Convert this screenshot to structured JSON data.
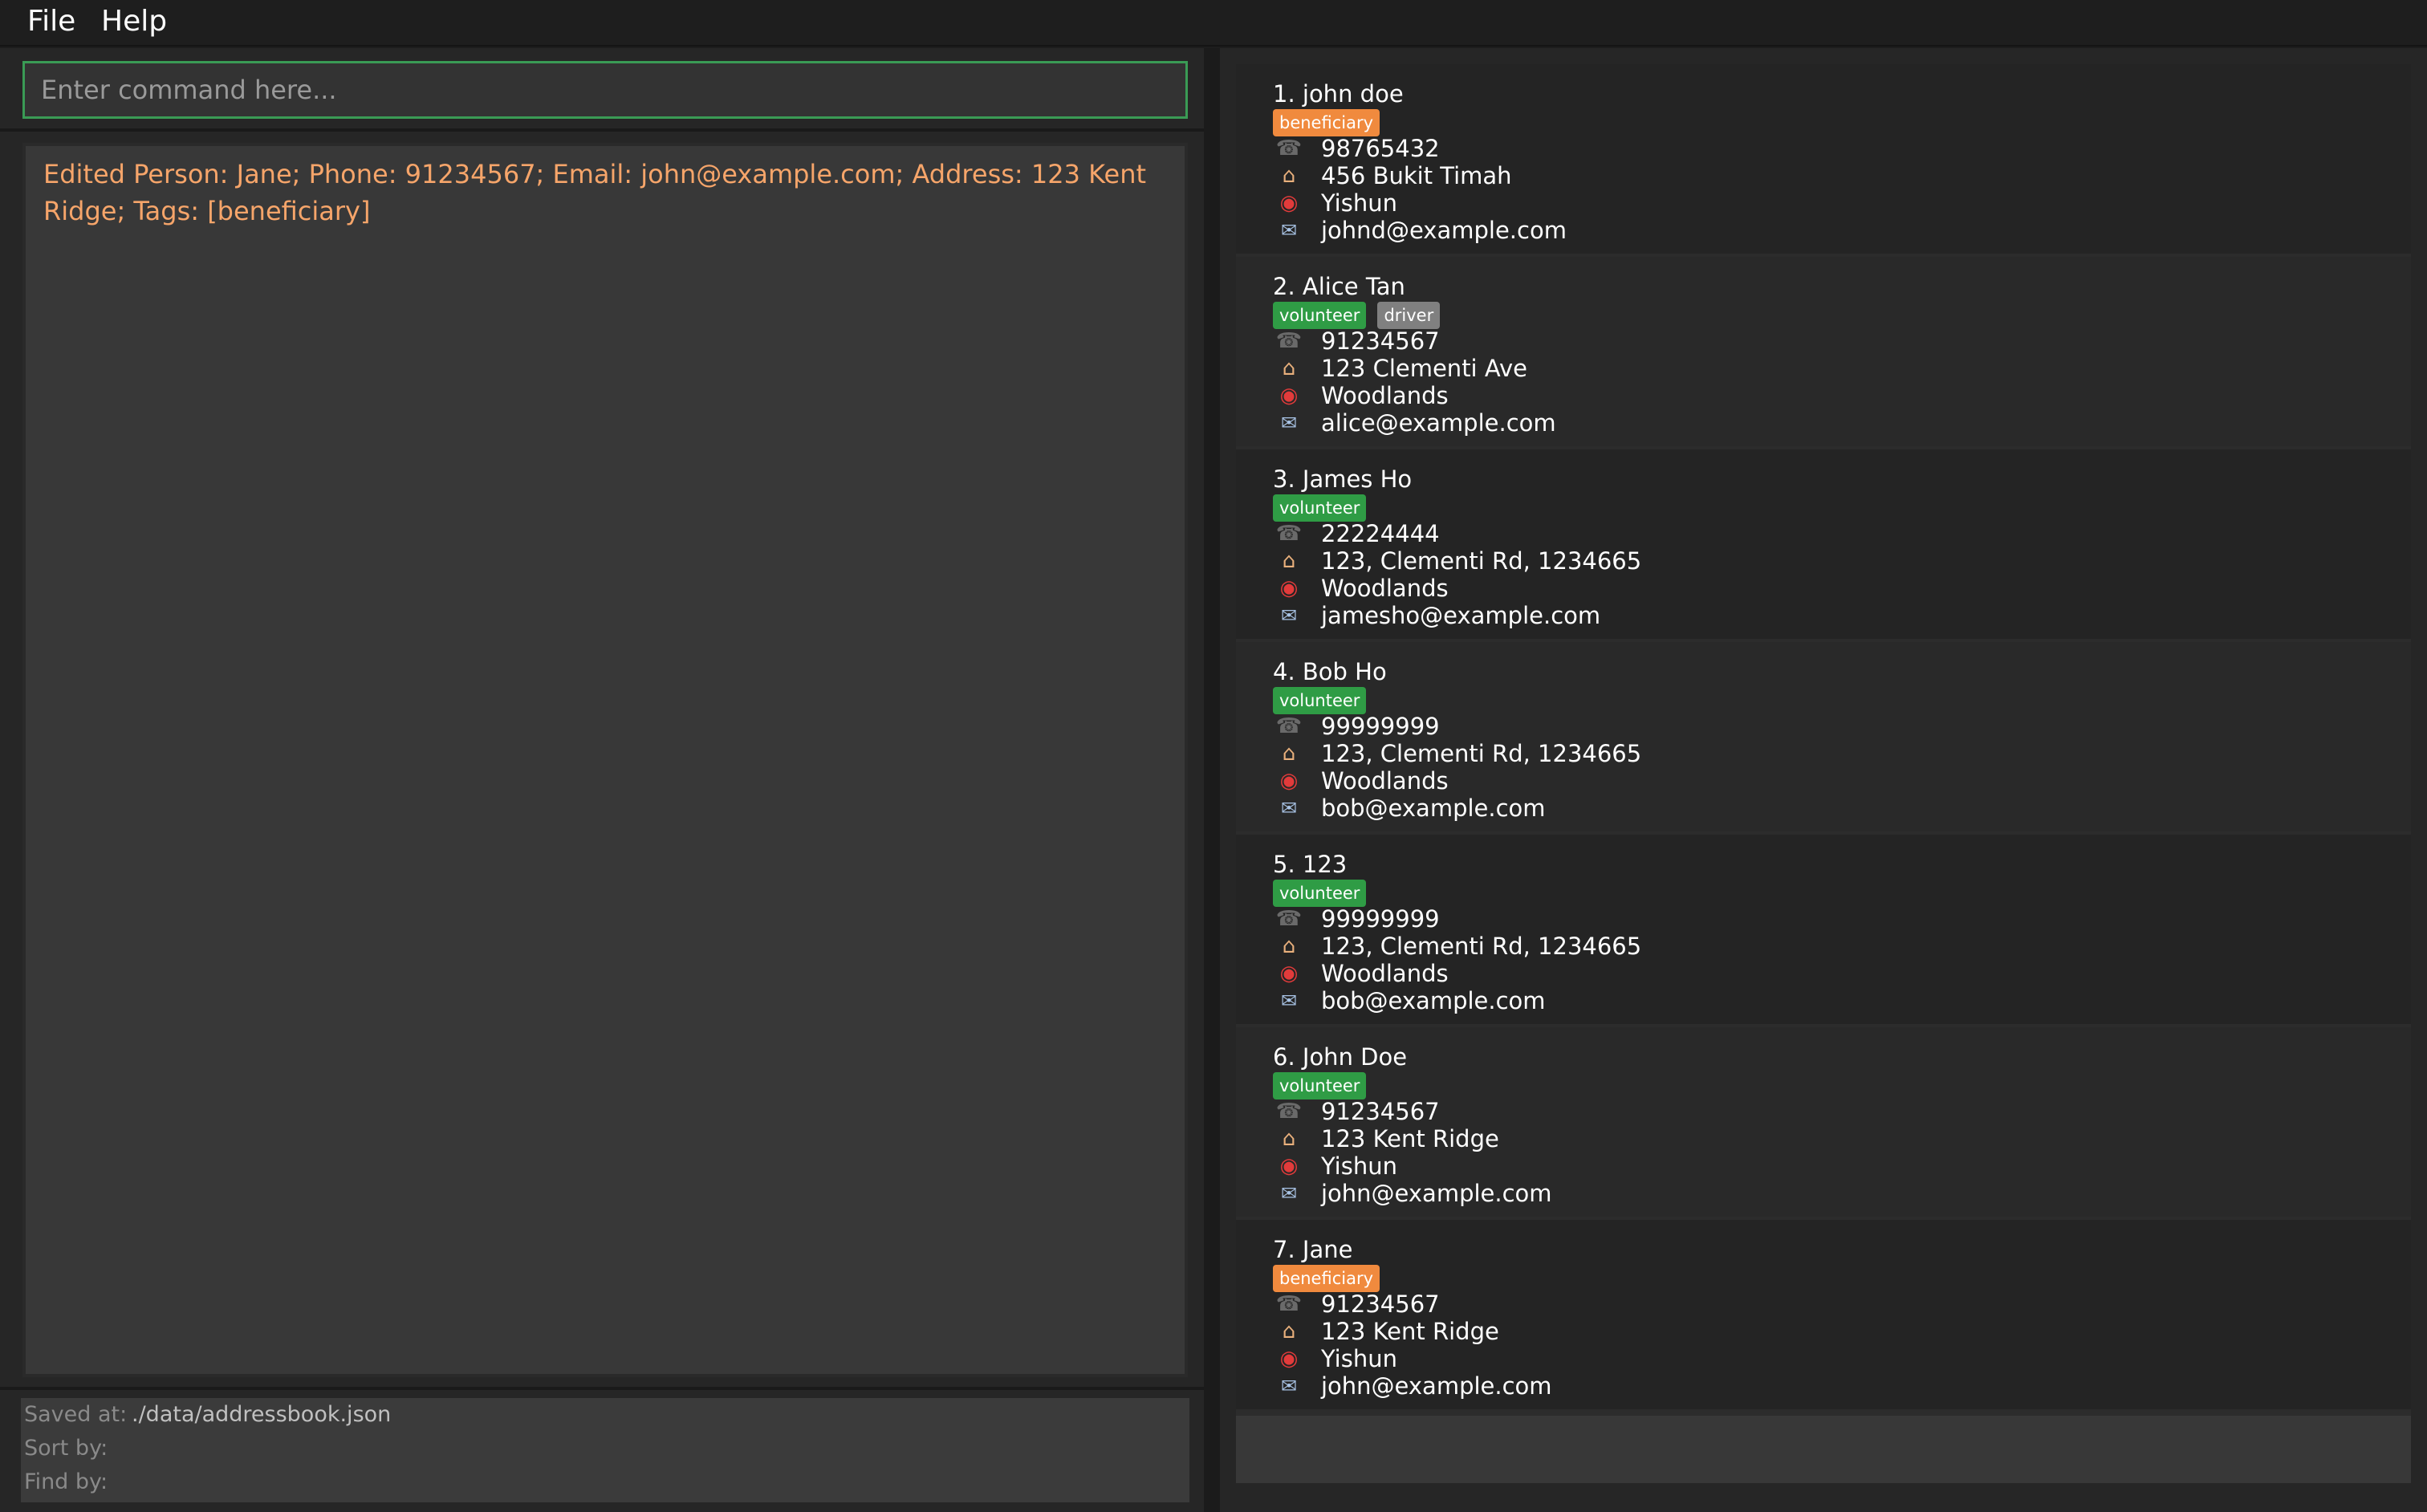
{
  "menu": {
    "file": "File",
    "help": "Help"
  },
  "command": {
    "placeholder": "Enter command here...",
    "value": ""
  },
  "result": {
    "message": "Edited Person: Jane; Phone: 91234567; Email: john@example.com; Address: 123 Kent Ridge; Tags: [beneficiary]"
  },
  "status": {
    "saved_label": "Saved at:",
    "saved_value": "./data/addressbook.json",
    "sort_label": "Sort by:",
    "sort_value": "",
    "find_label": "Find by:",
    "find_value": ""
  },
  "icons": {
    "phone": "phone-icon",
    "address": "house-icon",
    "region": "pin-icon",
    "email": "email-icon"
  },
  "tag_colors": {
    "beneficiary": "#f08a3e",
    "volunteer": "#2f9c45",
    "driver": "#808080"
  },
  "persons": [
    {
      "name": "1. john doe",
      "tags": [
        "beneficiary"
      ],
      "phone": "98765432",
      "address": "456 Bukit Timah",
      "region": "Yishun",
      "email": "johnd@example.com"
    },
    {
      "name": "2. Alice Tan",
      "tags": [
        "volunteer",
        "driver"
      ],
      "phone": "91234567",
      "address": "123 Clementi Ave",
      "region": "Woodlands",
      "email": "alice@example.com"
    },
    {
      "name": "3. James Ho",
      "tags": [
        "volunteer"
      ],
      "phone": "22224444",
      "address": "123, Clementi Rd, 1234665",
      "region": "Woodlands",
      "email": "jamesho@example.com"
    },
    {
      "name": "4. Bob Ho",
      "tags": [
        "volunteer"
      ],
      "phone": "99999999",
      "address": "123, Clementi Rd, 1234665",
      "region": "Woodlands",
      "email": "bob@example.com"
    },
    {
      "name": "5. 123",
      "tags": [
        "volunteer"
      ],
      "phone": "99999999",
      "address": "123, Clementi Rd, 1234665",
      "region": "Woodlands",
      "email": "bob@example.com"
    },
    {
      "name": "6. John Doe",
      "tags": [
        "volunteer"
      ],
      "phone": "91234567",
      "address": "123 Kent Ridge",
      "region": "Yishun",
      "email": "john@example.com"
    },
    {
      "name": "7. Jane",
      "tags": [
        "beneficiary"
      ],
      "phone": "91234567",
      "address": "123 Kent Ridge",
      "region": "Yishun",
      "email": "john@example.com"
    }
  ]
}
